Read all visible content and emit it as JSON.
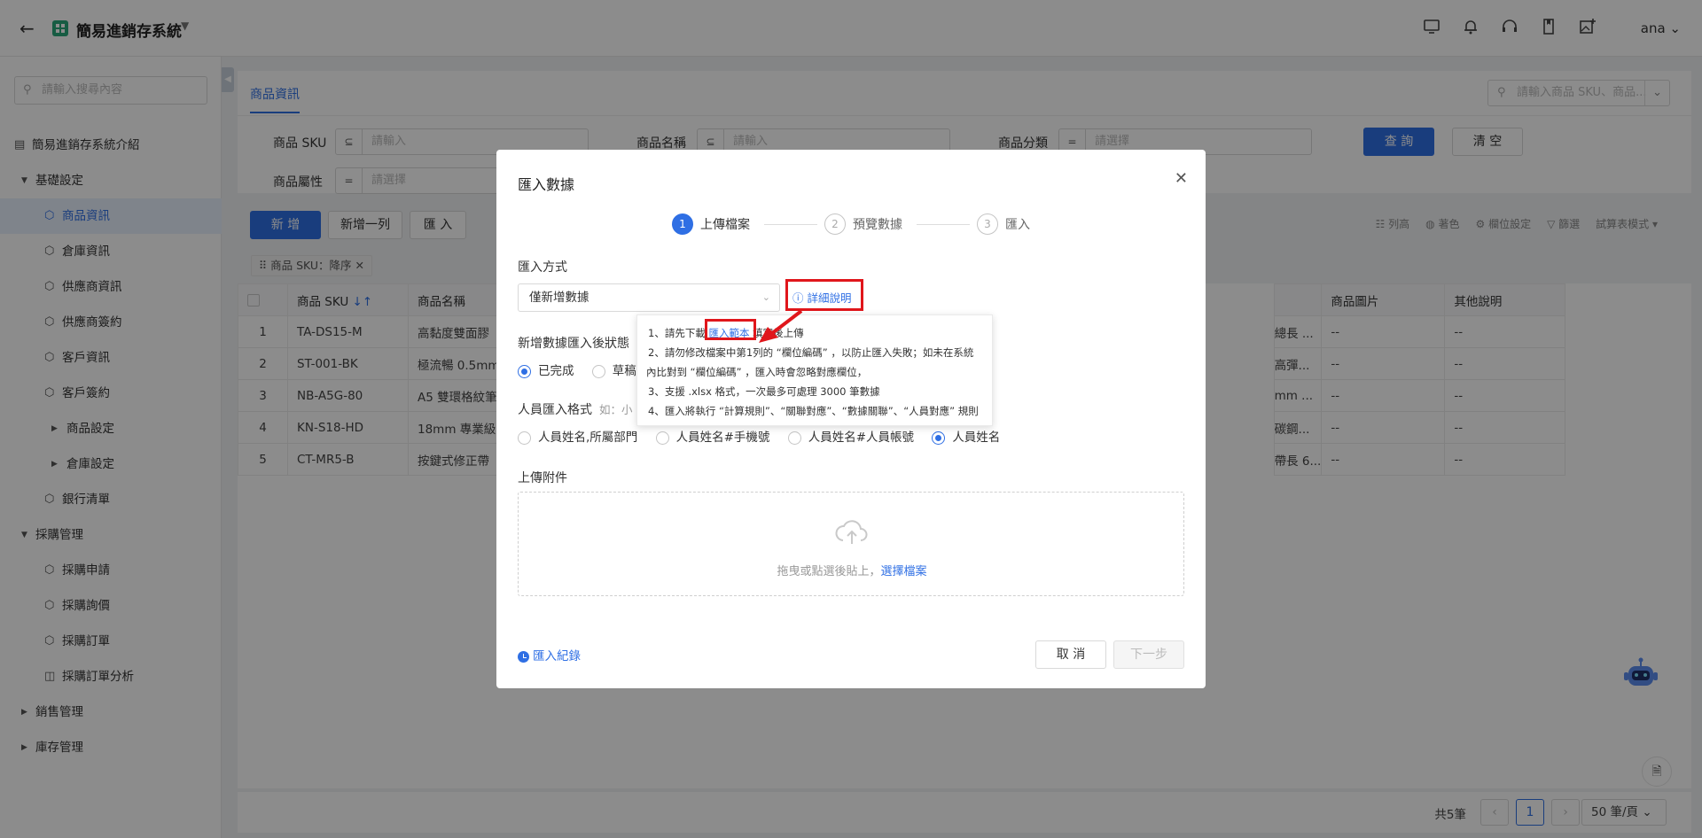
{
  "header": {
    "app_title": "簡易進銷存系統",
    "user": "ana",
    "icons": [
      "monitor-icon",
      "bell-icon",
      "headset-icon",
      "bookmark-icon",
      "image-plus-icon"
    ]
  },
  "sidebar": {
    "search_placeholder": "請輸入搜尋內容",
    "items": [
      {
        "label": "簡易進銷存系統介紹"
      },
      {
        "label": "基礎設定"
      },
      {
        "label": "商品資訊"
      },
      {
        "label": "倉庫資訊"
      },
      {
        "label": "供應商資訊"
      },
      {
        "label": "供應商簽約"
      },
      {
        "label": "客戶資訊"
      },
      {
        "label": "客戶簽約"
      },
      {
        "label": "商品設定"
      },
      {
        "label": "倉庫設定"
      },
      {
        "label": "銀行清單"
      },
      {
        "label": "採購管理"
      },
      {
        "label": "採購申請"
      },
      {
        "label": "採購詢價"
      },
      {
        "label": "採購訂單"
      },
      {
        "label": "採購訂單分析"
      },
      {
        "label": "銷售管理"
      },
      {
        "label": "庫存管理"
      }
    ]
  },
  "main": {
    "tab": "商品資訊",
    "global_search_placeholder": "請輸入商品 SKU、商品...",
    "filters": {
      "sku_label": "商品 SKU",
      "name_label": "商品名稱",
      "category_label": "商品分類",
      "attr_label": "商品屬性",
      "input_placeholder": "請輸入",
      "select_placeholder": "請選擇",
      "query": "查 詢",
      "clear": "清 空"
    },
    "toolbar": {
      "add": "新 增",
      "add_row": "新增一列",
      "import": "匯 入",
      "right": [
        "列高",
        "著色",
        "欄位設定",
        "篩選",
        "試算表模式"
      ]
    },
    "sort_chip": "商品 SKU：降序",
    "columns": [
      "商品 SKU",
      "商品名稱",
      "商品圖片",
      "其他說明"
    ],
    "rows": [
      {
        "no": "1",
        "sku": "TA-DS15-M",
        "name": "高黏度雙面膠",
        "tail": "總長 ...",
        "img": "--",
        "note": "--"
      },
      {
        "no": "2",
        "sku": "ST-001-BK",
        "name": "極流暢 0.5mm",
        "tail": "高彈...",
        "img": "--",
        "note": "--"
      },
      {
        "no": "3",
        "sku": "NB-A5G-80",
        "name": "A5 雙環格紋筆",
        "tail": "mm ...",
        "img": "--",
        "note": "--"
      },
      {
        "no": "4",
        "sku": "KN-S18-HD",
        "name": "18mm 專業級",
        "tail": "碳鋼...",
        "img": "--",
        "note": "--"
      },
      {
        "no": "5",
        "sku": "CT-MR5-B",
        "name": "按鍵式修正帶",
        "tail": "帶長 6...",
        "img": "--",
        "note": "--"
      }
    ],
    "pager": {
      "total": "共5筆",
      "page": "1",
      "size": "50 筆/頁"
    }
  },
  "modal": {
    "title": "匯入數據",
    "steps": [
      {
        "num": "1",
        "label": "上傳檔案"
      },
      {
        "num": "2",
        "label": "預覽數據"
      },
      {
        "num": "3",
        "label": "匯入"
      }
    ],
    "method_label": "匯入方式",
    "method_value": "僅新增數據",
    "detail_link": "詳細說明",
    "status_label": "新增數據匯入後狀態",
    "status_options": [
      "已完成",
      "草稿"
    ],
    "people_label": "人員匯入格式",
    "people_hint": "如：小",
    "people_options": [
      "人員姓名,所屬部門",
      "人員姓名#手機號",
      "人員姓名#人員帳號",
      "人員姓名"
    ],
    "popover": {
      "line1_a": "1、請先下載",
      "line1_link": "匯入範本",
      "line1_b": "填寫後上傳",
      "line2": "2、請勿修改檔案中第1列的 “欄位編碼” ，以防止匯入失敗；如未在系統",
      "line3": "內比對到 “欄位編碼” ，匯入時會忽略對應欄位，",
      "line4": "3、支援 .xlsx 格式，一次最多可處理 3000 筆數據",
      "line5": "4、匯入將執行 “計算規則”、“關聯對應”、“數據關聯”、“人員對應” 規則"
    },
    "upload_label": "上傳附件",
    "upload_hint": "拖曳或點選後貼上，",
    "upload_link": "選擇檔案",
    "import_log": "匯入紀錄",
    "cancel": "取 消",
    "next": "下一步",
    "accent": "#2f6fe4",
    "annotation_color": "#e0161b"
  }
}
